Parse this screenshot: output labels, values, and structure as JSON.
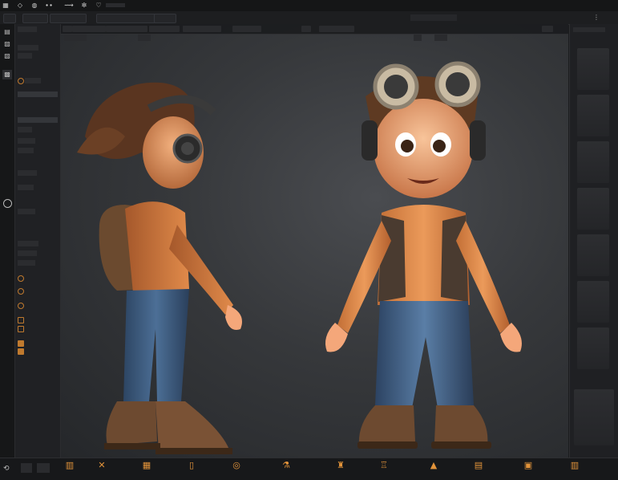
{
  "topbar": {
    "icons": [
      "grid-icon",
      "diamond-icon",
      "palette-icon",
      "wand-icon",
      "gear-icon",
      "heart-icon"
    ],
    "project_title": "",
    "frame_counter": ""
  },
  "menubar": {
    "items": [
      "",
      "",
      "",
      "",
      "",
      "",
      "",
      "",
      "",
      "",
      ""
    ],
    "viewport_title": ""
  },
  "toolstrip": {
    "tools": [
      "layout-icon",
      "graph-icon",
      "node-icon",
      "scene-icon",
      "material-icon",
      "render-icon",
      "circle-select-icon",
      "orbit-icon"
    ]
  },
  "outliner": {
    "rows": []
  },
  "viewport": {
    "tabs": [
      "",
      "",
      "",
      "",
      "",
      "",
      "",
      "",
      "",
      ""
    ],
    "sub": [
      "",
      "",
      "",
      ""
    ],
    "views": [
      "side-view",
      "front-view"
    ]
  },
  "right_panel": {
    "thumbnails": [
      {
        "label": ""
      },
      {
        "label": ""
      },
      {
        "label": ""
      },
      {
        "label": ""
      },
      {
        "label": ""
      },
      {
        "label": ""
      },
      {
        "label": ""
      },
      {
        "label": ""
      }
    ]
  },
  "bottombar": {
    "tools": [
      {
        "icon": "rig-icon",
        "label": ""
      },
      {
        "icon": "cross-tool-icon",
        "label": ""
      },
      {
        "icon": "brush-icon",
        "label": ""
      },
      {
        "icon": "phone-icon",
        "label": ""
      },
      {
        "icon": "target-icon",
        "label": ""
      },
      {
        "icon": "sculpt-icon",
        "label": ""
      },
      {
        "icon": "character-icon",
        "label": ""
      },
      {
        "icon": "animation-icon",
        "label": ""
      },
      {
        "icon": "export-icon",
        "label": ""
      },
      {
        "icon": "doc-icon",
        "label": ""
      },
      {
        "icon": "stack-icon",
        "label": ""
      }
    ]
  },
  "colors": {
    "accent": "#e2933a",
    "panel": "#202124",
    "viewport_center": "#4a4c50"
  }
}
